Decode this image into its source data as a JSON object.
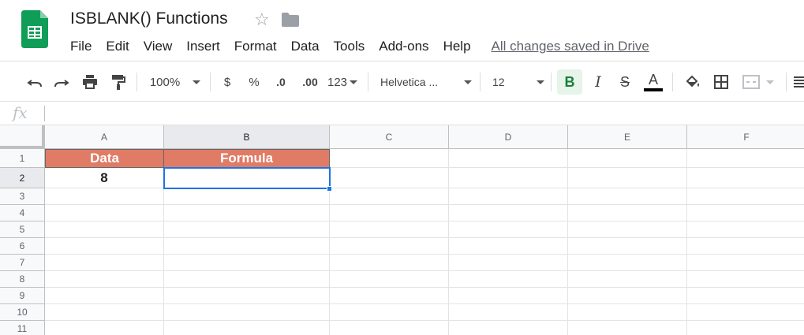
{
  "document": {
    "title": "ISBLANK() Functions",
    "save_status": "All changes saved in Drive"
  },
  "menu": [
    "File",
    "Edit",
    "View",
    "Insert",
    "Format",
    "Data",
    "Tools",
    "Add-ons",
    "Help"
  ],
  "toolbar": {
    "zoom": "100%",
    "currency": "$",
    "percent": "%",
    "decrease_decimals": ".0",
    "increase_decimals": ".00",
    "more_formats": "123",
    "font": "Helvetica ...",
    "font_size": "12",
    "bold": "B",
    "italic": "I",
    "strikethrough": "S",
    "text_color": "A"
  },
  "formula_bar": {
    "icon": "fx",
    "value": ""
  },
  "sheet": {
    "columns": [
      "A",
      "B",
      "C",
      "D",
      "E",
      "F"
    ],
    "rows": [
      "1",
      "2",
      "3",
      "4",
      "5",
      "6",
      "7",
      "8",
      "9",
      "10",
      "11"
    ],
    "active_cell": "B2",
    "cells": {
      "A1": "Data",
      "B1": "Formula",
      "A2": "8",
      "B2": ""
    }
  },
  "colors": {
    "header_fill": "#e07b66",
    "header_text": "#ffffff",
    "selection": "#1a73e8",
    "logo_green": "#0f9d58"
  },
  "icons": [
    "sheets-logo-icon",
    "star-icon",
    "folder-icon",
    "undo-icon",
    "redo-icon",
    "print-icon",
    "paint-format-icon",
    "fill-color-icon",
    "borders-icon",
    "merge-cells-icon",
    "align-icon"
  ]
}
